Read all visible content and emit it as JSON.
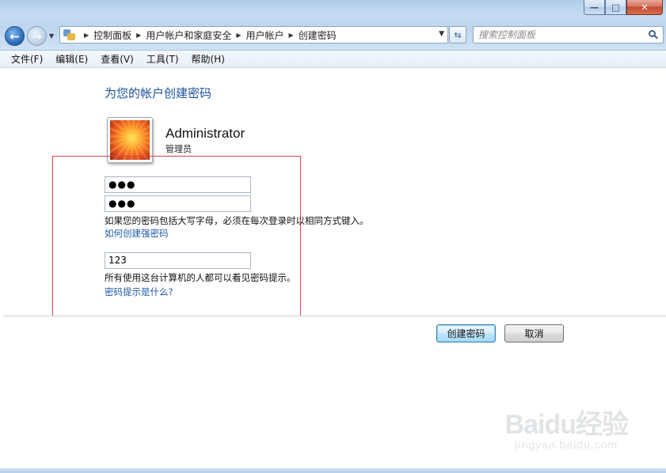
{
  "window": {
    "minimize_glyph": "—",
    "maximize_glyph": "□",
    "close_glyph": "✕"
  },
  "address": {
    "crumbs": [
      "控制面板",
      "用户帐户和家庭安全",
      "用户帐户",
      "创建密码"
    ]
  },
  "search": {
    "placeholder": "搜索控制面板"
  },
  "menu": {
    "items": [
      "文件(F)",
      "编辑(E)",
      "查看(V)",
      "工具(T)",
      "帮助(H)"
    ]
  },
  "main": {
    "title": "为您的帐户创建密码",
    "user_name": "Administrator",
    "user_role": "管理员",
    "password_value": "●●●",
    "confirm_value": "●●●",
    "case_note": "如果您的密码包括大写字母，必须在每次登录时以相同方式键入。",
    "strong_link": "如何创建强密码",
    "hint_value": "123",
    "hint_note": "所有使用这台计算机的人都可以看见密码提示。",
    "hint_link": "密码提示是什么?",
    "create_button": "创建密码",
    "cancel_button": "取消"
  },
  "watermark": {
    "logo": "Baidu经验",
    "url": "jingyan.baidu.com"
  },
  "colors": {
    "title_blue": "#1b4f9a",
    "link_blue": "#1d5aa5",
    "highlight_red": "#d94545"
  }
}
